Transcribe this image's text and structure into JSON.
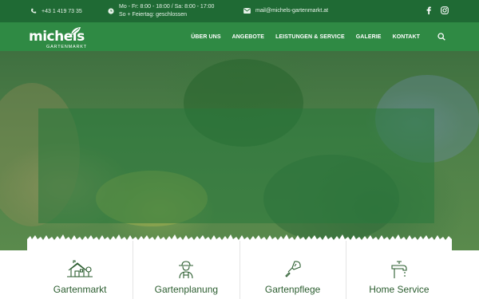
{
  "topbar": {
    "phone": "+43 1 419 73 35",
    "hours_line1": "Mo - Fr: 8:00 - 18:00 / Sa: 8:00 - 17:00",
    "hours_line2": "So + Feiertag: geschlossen",
    "email": "mail@michels-gartenmarkt.at",
    "icons": [
      "phone-icon",
      "clock-icon",
      "mail-icon",
      "facebook-icon",
      "instagram-icon"
    ]
  },
  "brand": {
    "logo_text": "michels",
    "logo_sub": "GARTENMARKT"
  },
  "nav": {
    "items": [
      "ÜBER UNS",
      "ANGEBOTE",
      "LEISTUNGEN & SERVICE",
      "GALERIE",
      "KONTAKT"
    ]
  },
  "services": [
    {
      "label": "Gartenmarkt",
      "icon": "house-icon"
    },
    {
      "label": "Gartenplanung",
      "icon": "gardener-icon"
    },
    {
      "label": "Gartenpflege",
      "icon": "trowel-icon"
    },
    {
      "label": "Home Service",
      "icon": "faucet-icon"
    }
  ],
  "colors": {
    "topbar": "#1f6a34",
    "nav": "#2f8a44",
    "accent_text": "#2b5d2f"
  }
}
